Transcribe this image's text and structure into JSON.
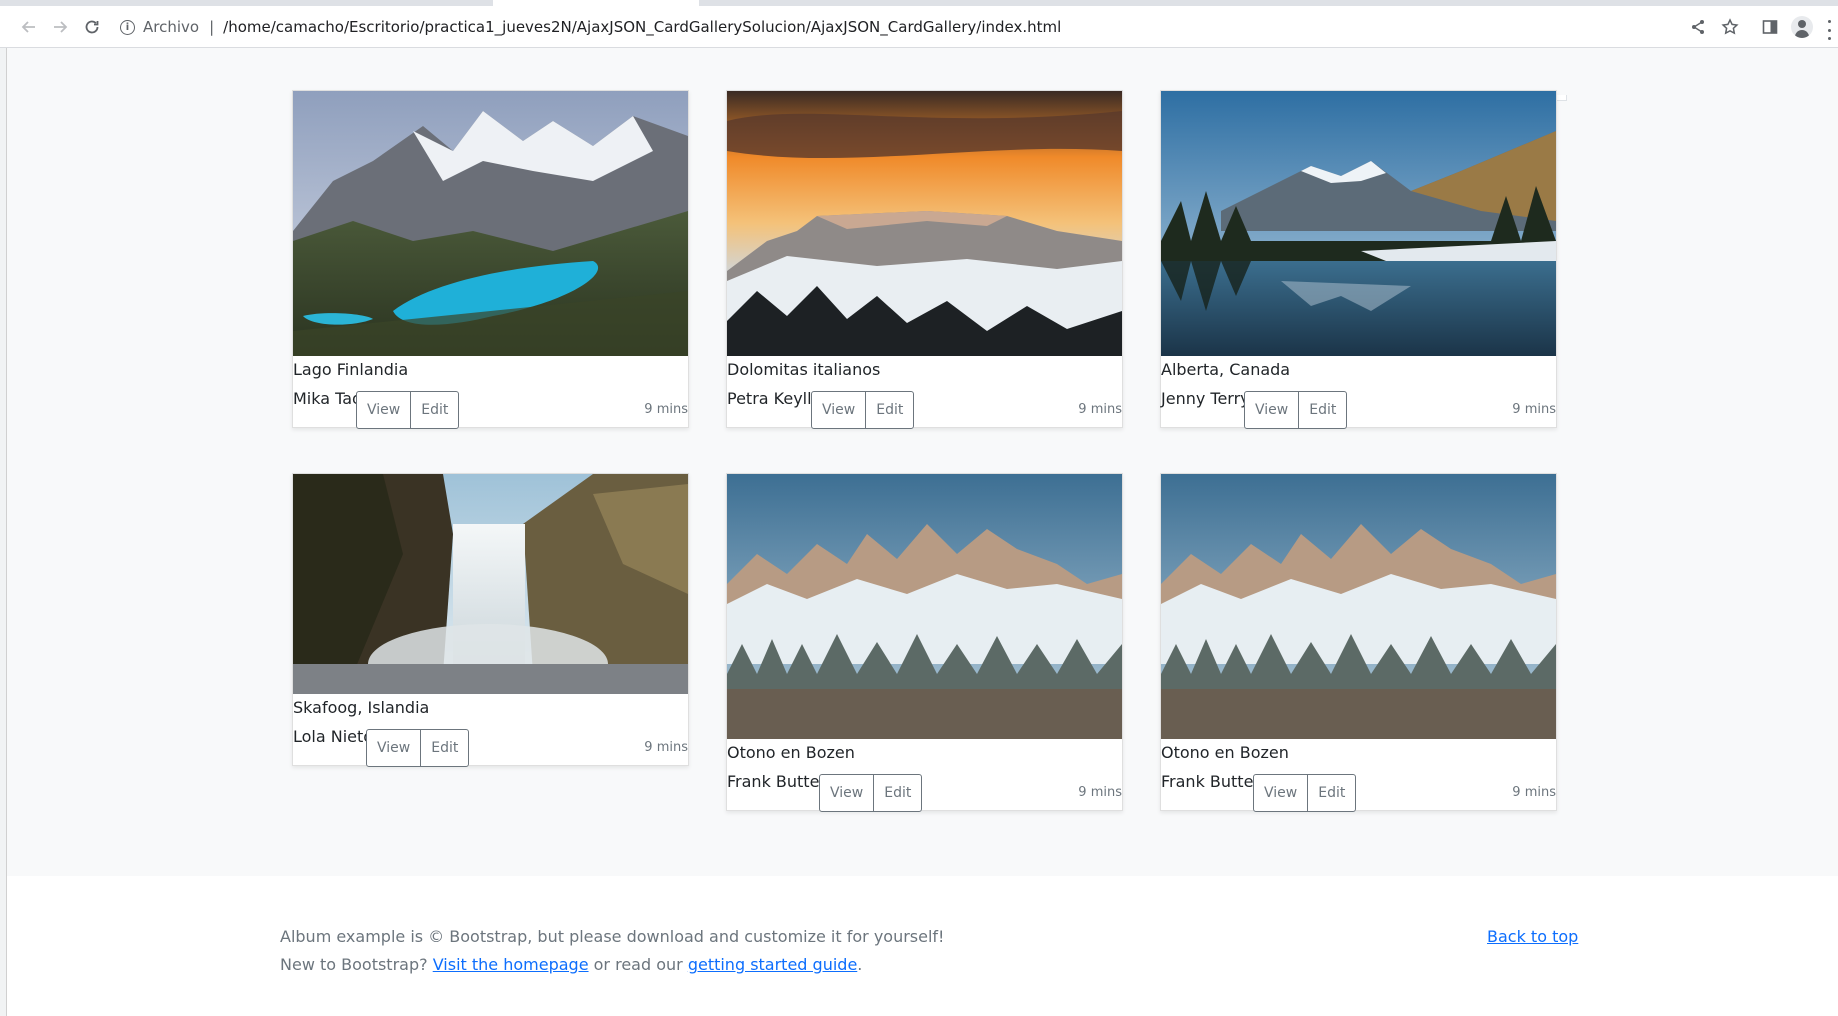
{
  "browser": {
    "scheme_label": "Archivo",
    "url": "/home/camacho/Escritorio/practica1_jueves2N/AjaxJSON_CardGallerySolucion/AjaxJSON_CardGallery/index.html"
  },
  "cards": [
    {
      "title": "Lago Finlandia",
      "author": "Mika Tao",
      "view_label": "View",
      "edit_label": "Edit",
      "time": "9 mins"
    },
    {
      "title": "Dolomitas italianos",
      "author": "Petra Keylly",
      "view_label": "View",
      "edit_label": "Edit",
      "time": "9 mins"
    },
    {
      "title": "Alberta, Canada",
      "author": "Jenny Terry",
      "view_label": "View",
      "edit_label": "Edit",
      "time": "9 mins"
    },
    {
      "title": "Skafoog, Islandia",
      "author": "Lola Nieto",
      "view_label": "View",
      "edit_label": "Edit",
      "time": "9 mins"
    },
    {
      "title": "Otono en Bozen",
      "author": "Frank Butten",
      "view_label": "View",
      "edit_label": "Edit",
      "time": "9 mins"
    },
    {
      "title": "Otono en Bozen",
      "author": "Frank Butten",
      "view_label": "View",
      "edit_label": "Edit",
      "time": "9 mins"
    }
  ],
  "footer": {
    "line1": "Album example is © Bootstrap, but please download and customize it for yourself!",
    "line2_prefix": "New to Bootstrap?",
    "homepage_link": "Visit the homepage",
    "line2_middle": "or read our",
    "guide_link": "getting started guide",
    "line2_suffix": ".",
    "back_to_top": "Back to top"
  },
  "colors": {
    "album_bg": "#f8f9fa",
    "link": "#0d6efd",
    "muted": "#6c757d",
    "lake": "#1fb0d8",
    "sunset": "#f08a2a"
  }
}
